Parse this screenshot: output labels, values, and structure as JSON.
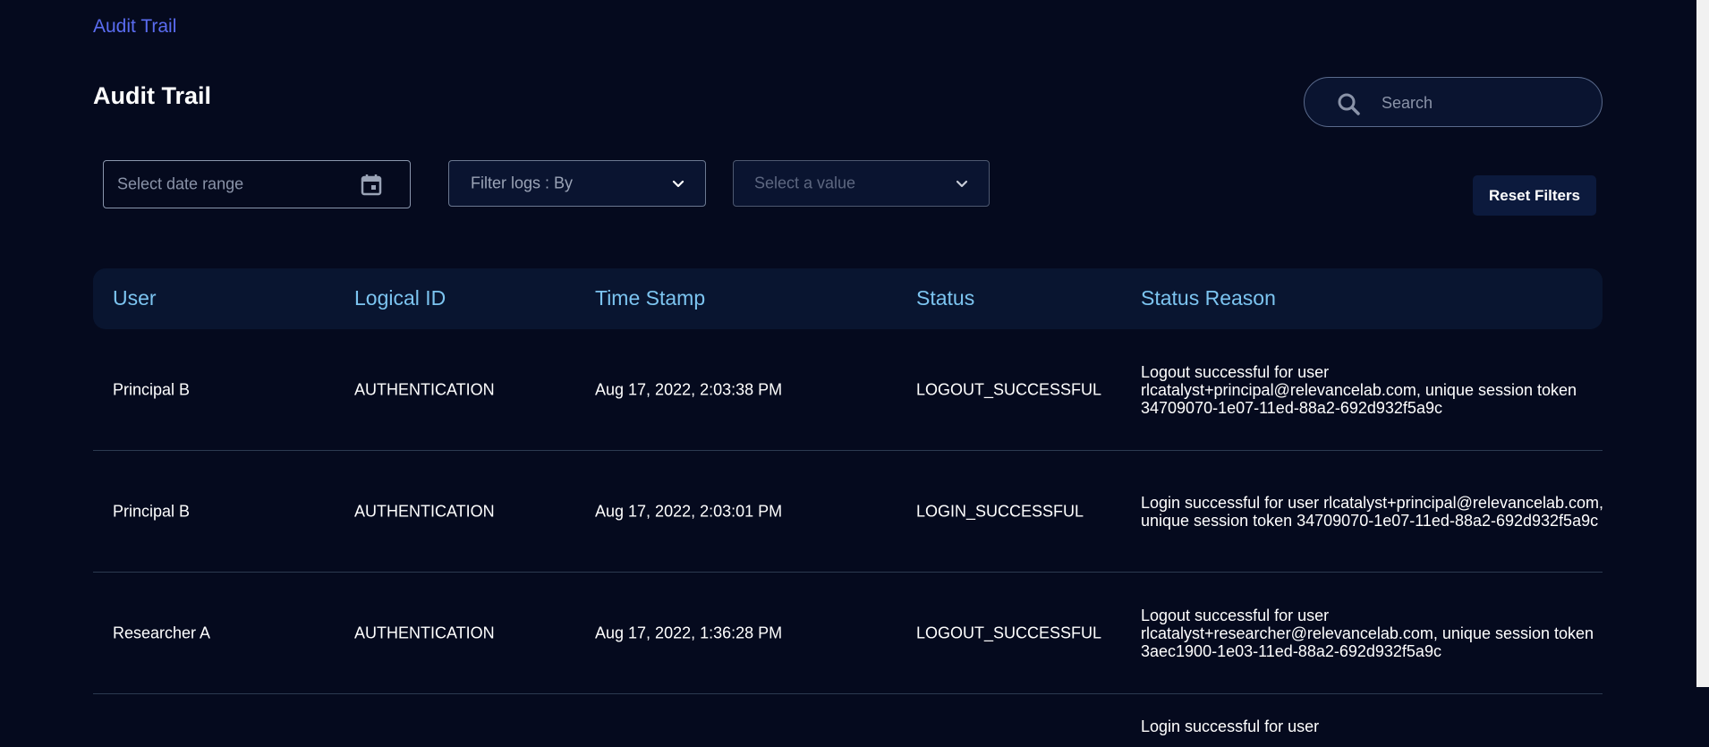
{
  "breadcrumb": "Audit Trail",
  "page_title": "Audit Trail",
  "search": {
    "placeholder": "Search",
    "icon": "search-icon"
  },
  "filters": {
    "date_placeholder": "Select date range",
    "date_icon": "calendar-icon",
    "logs_by_label": "Filter logs : By",
    "value_placeholder": "Select a value",
    "reset_label": "Reset Filters"
  },
  "table": {
    "headers": [
      "User",
      "Logical ID",
      "Time Stamp",
      "Status",
      "Status Reason"
    ],
    "rows": [
      {
        "user": "Principal B",
        "logical_id": "AUTHENTICATION",
        "timestamp": "Aug 17, 2022, 2:03:38 PM",
        "status": "LOGOUT_SUCCESSFUL",
        "reason": "Logout successful for user rlcatalyst+principal@relevancelab.com, unique session token 34709070-1e07-11ed-88a2-692d932f5a9c"
      },
      {
        "user": "Principal B",
        "logical_id": "AUTHENTICATION",
        "timestamp": "Aug 17, 2022, 2:03:01 PM",
        "status": "LOGIN_SUCCESSFUL",
        "reason": "Login successful for user rlcatalyst+principal@relevancelab.com, unique session token 34709070-1e07-11ed-88a2-692d932f5a9c"
      },
      {
        "user": "Researcher A",
        "logical_id": "AUTHENTICATION",
        "timestamp": "Aug 17, 2022, 1:36:28 PM",
        "status": "LOGOUT_SUCCESSFUL",
        "reason": "Logout successful for user rlcatalyst+researcher@relevancelab.com, unique session token 3aec1900-1e03-11ed-88a2-692d932f5a9c"
      },
      {
        "user": "",
        "logical_id": "",
        "timestamp": "",
        "status": "",
        "reason": "Login successful for user"
      }
    ]
  },
  "colors": {
    "background": "#050a1e",
    "accent_link": "#5a6cf0",
    "header_text": "#7cc4f0",
    "header_bg": "#091530"
  }
}
